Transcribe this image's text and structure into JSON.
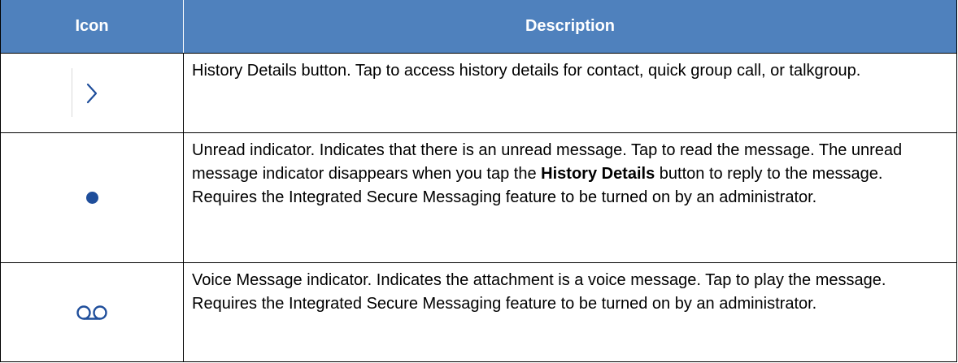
{
  "table": {
    "headers": {
      "icon": "Icon",
      "description": "Description"
    },
    "rows": [
      {
        "icon": "chevron-right-icon",
        "parts": [
          {
            "text": "History Details button. Tap to access history details for contact, quick group call, or talkgroup.",
            "bold": false
          }
        ]
      },
      {
        "icon": "unread-dot-icon",
        "parts": [
          {
            "text": "Unread indicator. Indicates that there is an unread message. Tap to read the message. The unread message indicator disappears when you tap the ",
            "bold": false
          },
          {
            "text": "History Details",
            "bold": true
          },
          {
            "text": " button to reply to the message. Requires the Integrated Secure Messaging feature to be turned on by an administrator.",
            "bold": false
          }
        ]
      },
      {
        "icon": "voicemail-icon",
        "parts": [
          {
            "text": "Voice Message indicator. Indicates the attachment is a voice message. Tap to play the message. Requires the Integrated Secure Messaging feature to be turned on by an administrator.",
            "bold": false
          }
        ]
      }
    ]
  },
  "colors": {
    "header_bg": "#4f81bd",
    "icon_blue": "#1f4e9b"
  }
}
